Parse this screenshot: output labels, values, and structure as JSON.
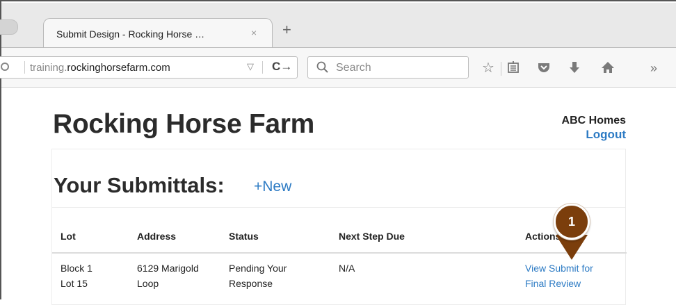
{
  "browser": {
    "tab_title": "Submit Design - Rocking Horse …",
    "tab_close": "×",
    "new_tab": "+",
    "url_prefix": "training.",
    "url_domain": "rockinghorsefarm.com",
    "search_placeholder": "Search",
    "icons": [
      "info-icon",
      "reload-icon",
      "search-icon",
      "bookmark-star-icon",
      "reading-list-icon",
      "pocket-icon",
      "download-icon",
      "home-icon",
      "overflow-chevron-icon"
    ]
  },
  "header": {
    "site_title": "Rocking Horse Farm",
    "user_name": "ABC Homes",
    "logout_label": "Logout"
  },
  "submittals": {
    "title": "Your Submittals:",
    "new_label": "+New",
    "columns": [
      "Lot",
      "Address",
      "Status",
      "Next Step Due",
      "Actions"
    ],
    "rows": [
      {
        "lot_line1": "Block 1",
        "lot_line2": "Lot 15",
        "address_line1": "6129 Marigold",
        "address_line2": "Loop",
        "status_line1": "Pending Your",
        "status_line2": "Response",
        "next_step": "N/A",
        "action_line1": "View Submit for",
        "action_line2": "Final Review"
      }
    ]
  },
  "callout": {
    "number": "1",
    "color": "#7b3e0c"
  },
  "colors": {
    "link": "#2d7bc4",
    "chrome": "#e9e9e9"
  }
}
